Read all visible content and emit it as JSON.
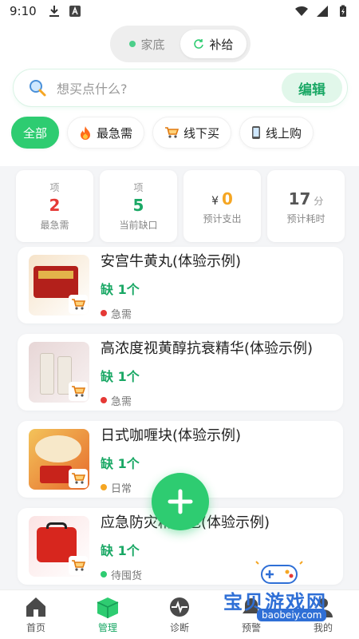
{
  "status": {
    "time": "9:10"
  },
  "segment": {
    "home_label": "家底",
    "replenish_label": "补给"
  },
  "search": {
    "placeholder": "想买点什么?",
    "edit_label": "编辑"
  },
  "filters": [
    {
      "label": "全部"
    },
    {
      "label": "最急需"
    },
    {
      "label": "线下买"
    },
    {
      "label": "线上购"
    }
  ],
  "stats": [
    {
      "unit": "项",
      "value": "2",
      "label": "最急需",
      "color": "#e53935"
    },
    {
      "unit": "项",
      "value": "5",
      "label": "当前缺口",
      "color": "#1aa865"
    },
    {
      "prefix": "¥",
      "value": "0",
      "label": "预计支出",
      "color": "#f5a623"
    },
    {
      "value": "17",
      "suffix": "分",
      "label": "预计耗时",
      "color": "#555555"
    }
  ],
  "items": [
    {
      "title": "安宫牛黄丸(体验示例)",
      "need": "缺 1个",
      "tag": "急需",
      "tag_color": "#e53935"
    },
    {
      "title": "高浓度视黄醇抗衰精华(体验示例)",
      "need": "缺 1个",
      "tag": "急需",
      "tag_color": "#e53935"
    },
    {
      "title": "日式咖喱块(体验示例)",
      "need": "缺 1个",
      "tag": "日常",
      "tag_color": "#f5a623"
    },
    {
      "title": "应急防灾精华包(体验示例)",
      "need": "缺 1个",
      "tag": "待囤货",
      "tag_color": "#2ecc71"
    }
  ],
  "tabs": [
    {
      "label": "首页"
    },
    {
      "label": "管理"
    },
    {
      "label": "诊断"
    },
    {
      "label": "预警"
    },
    {
      "label": "我的"
    }
  ],
  "watermark": {
    "text": "宝贝游戏网",
    "url": "baobeiy.com"
  },
  "colors": {
    "accent": "#2ecc71",
    "accent_dark": "#1aa865"
  }
}
